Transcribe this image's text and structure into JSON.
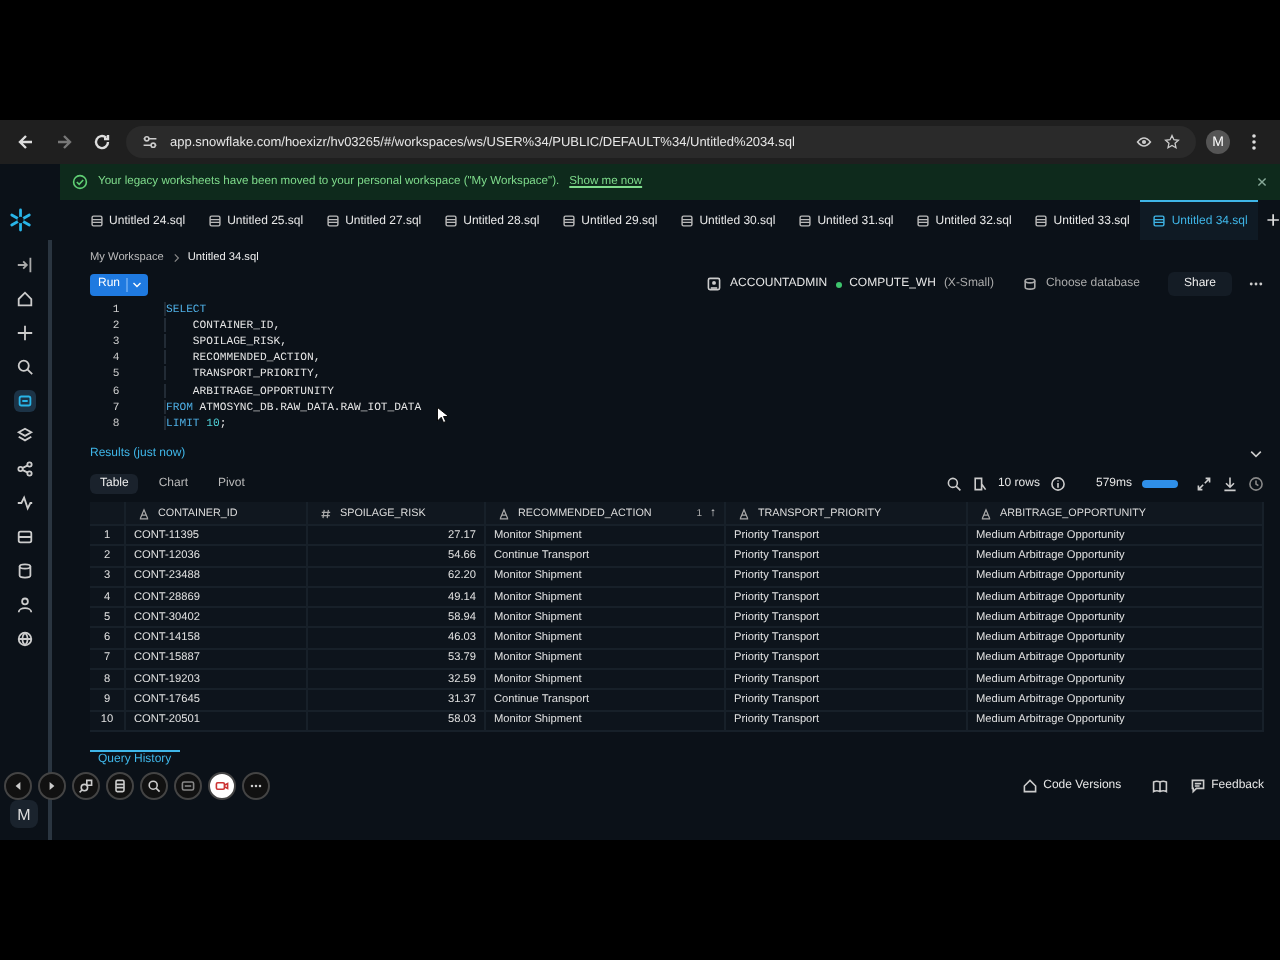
{
  "browser": {
    "url": "app.snowflake.com/hoexizr/hv03265/#/workspaces/ws/USER%34/PUBLIC/DEFAULT%34/Untitled%2034.sql",
    "avatar": "M"
  },
  "banner": {
    "message": "Your legacy worksheets have been moved to your personal workspace (\"My Workspace\").",
    "link": "Show me now"
  },
  "tabs": [
    {
      "label": "Untitled 24.sql",
      "selected": false
    },
    {
      "label": "Untitled 25.sql",
      "selected": false
    },
    {
      "label": "Untitled 27.sql",
      "selected": false
    },
    {
      "label": "Untitled 28.sql",
      "selected": false
    },
    {
      "label": "Untitled 29.sql",
      "selected": false
    },
    {
      "label": "Untitled 30.sql",
      "selected": false
    },
    {
      "label": "Untitled 31.sql",
      "selected": false
    },
    {
      "label": "Untitled 32.sql",
      "selected": false
    },
    {
      "label": "Untitled 33.sql",
      "selected": false
    },
    {
      "label": "Untitled 34.sql",
      "selected": true
    }
  ],
  "breadcrumb": [
    "My Workspace",
    "Untitled 34.sql"
  ],
  "toolbar": {
    "run": "Run",
    "role": "ACCOUNTADMIN",
    "warehouse": "COMPUTE_WH",
    "size": "(X-Small)",
    "database": "Choose database",
    "share": "Share"
  },
  "code": [
    {
      "number": "1",
      "tokens": [
        {
          "kind": "keyword",
          "text": "SELECT"
        }
      ]
    },
    {
      "number": "2",
      "tokens": [
        {
          "kind": "plain",
          "text": "    CONTAINER_ID,"
        }
      ]
    },
    {
      "number": "3",
      "tokens": [
        {
          "kind": "plain",
          "text": "    SPOILAGE_RISK,"
        }
      ]
    },
    {
      "number": "4",
      "tokens": [
        {
          "kind": "plain",
          "text": "    RECOMMENDED_ACTION,"
        }
      ]
    },
    {
      "number": "5",
      "tokens": [
        {
          "kind": "plain",
          "text": "    TRANSPORT_PRIORITY,"
        }
      ]
    },
    {
      "number": "6",
      "tokens": [
        {
          "kind": "plain",
          "text": "    ARBITRAGE_OPPORTUNITY"
        }
      ]
    },
    {
      "number": "7",
      "tokens": [
        {
          "kind": "keyword",
          "text": "FROM"
        },
        {
          "kind": "plain",
          "text": " ATMOSYNC_DB.RAW_DATA.RAW_IOT_DATA"
        }
      ]
    },
    {
      "number": "8",
      "tokens": [
        {
          "kind": "keyword",
          "text": "LIMIT"
        },
        {
          "kind": "number",
          "text": " 10"
        },
        {
          "kind": "plain",
          "text": ";"
        }
      ]
    }
  ],
  "results": {
    "title": "Results (just now)",
    "views": [
      {
        "label": "Table",
        "selected": true
      },
      {
        "label": "Chart",
        "selected": false
      },
      {
        "label": "Pivot",
        "selected": false
      }
    ],
    "row_count": "10 rows",
    "duration": "579ms",
    "columns": [
      {
        "name": "CONTAINER_ID",
        "kind": "text"
      },
      {
        "name": "SPOILAGE_RISK",
        "kind": "number"
      },
      {
        "name": "RECOMMENDED_ACTION",
        "kind": "text",
        "sort": {
          "order": "1",
          "arrow": "↑"
        }
      },
      {
        "name": "TRANSPORT_PRIORITY",
        "kind": "text"
      },
      {
        "name": "ARBITRAGE_OPPORTUNITY",
        "kind": "text"
      }
    ],
    "rows": [
      {
        "number": "1",
        "cells": [
          "CONT-11395",
          "27.17",
          "Monitor Shipment",
          "Priority Transport",
          "Medium Arbitrage Opportunity"
        ]
      },
      {
        "number": "2",
        "cells": [
          "CONT-12036",
          "54.66",
          "Continue Transport",
          "Priority Transport",
          "Medium Arbitrage Opportunity"
        ]
      },
      {
        "number": "3",
        "cells": [
          "CONT-23488",
          "62.20",
          "Monitor Shipment",
          "Priority Transport",
          "Medium Arbitrage Opportunity"
        ]
      },
      {
        "number": "4",
        "cells": [
          "CONT-28869",
          "49.14",
          "Monitor Shipment",
          "Priority Transport",
          "Medium Arbitrage Opportunity"
        ]
      },
      {
        "number": "5",
        "cells": [
          "CONT-30402",
          "58.94",
          "Monitor Shipment",
          "Priority Transport",
          "Medium Arbitrage Opportunity"
        ]
      },
      {
        "number": "6",
        "cells": [
          "CONT-14158",
          "46.03",
          "Monitor Shipment",
          "Priority Transport",
          "Medium Arbitrage Opportunity"
        ]
      },
      {
        "number": "7",
        "cells": [
          "CONT-15887",
          "53.79",
          "Monitor Shipment",
          "Priority Transport",
          "Medium Arbitrage Opportunity"
        ]
      },
      {
        "number": "8",
        "cells": [
          "CONT-19203",
          "32.59",
          "Monitor Shipment",
          "Priority Transport",
          "Medium Arbitrage Opportunity"
        ]
      },
      {
        "number": "9",
        "cells": [
          "CONT-17645",
          "31.37",
          "Continue Transport",
          "Priority Transport",
          "Medium Arbitrage Opportunity"
        ]
      },
      {
        "number": "10",
        "cells": [
          "CONT-20501",
          "58.03",
          "Monitor Shipment",
          "Priority Transport",
          "Medium Arbitrage Opportunity"
        ]
      }
    ]
  },
  "query_history": "Query History",
  "footer": {
    "code_versions": "Code Versions",
    "feedback": "Feedback"
  },
  "user_initial": "M"
}
